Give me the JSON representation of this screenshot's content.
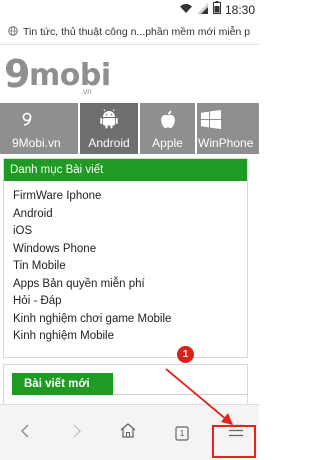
{
  "status_bar": {
    "time": "18:30"
  },
  "address_bar": {
    "url_text": "Tin tức, thủ thuật công n...phần mềm mới miễn p"
  },
  "logo": {
    "nine": "9",
    "mobi": "mobi",
    "vn": ".vn"
  },
  "tabs": [
    {
      "label": "9Mobi.vn",
      "icon": "9mobi-logo-icon"
    },
    {
      "label": "Android",
      "icon": "android-icon"
    },
    {
      "label": "Apple",
      "icon": "apple-icon"
    },
    {
      "label": "WinPhone",
      "icon": "windows-icon"
    }
  ],
  "section": {
    "title": "Danh mục Bài viết",
    "items": [
      "FirmWare Iphone",
      "Android",
      "iOS",
      "Windows Phone",
      "Tin Mobile",
      "Apps Bản quyền miễn phí",
      "Hỏi - Đáp",
      "Kinh nghiệm chơi game Mobile",
      "Kinh nghiệm Mobile"
    ]
  },
  "section2": {
    "title": "Bài viết mới"
  },
  "bottom_nav": {
    "tabs_count": "1",
    "icons": [
      "back-icon",
      "forward-icon",
      "home-icon",
      "tabs-icon",
      "menu-icon"
    ]
  },
  "annotation": {
    "badge": "1",
    "color": "#e8211d"
  },
  "colors": {
    "accent_green": "#1f9a22",
    "tab_gray": "#8f8f8f",
    "tab_active": "#6f6f6f"
  }
}
